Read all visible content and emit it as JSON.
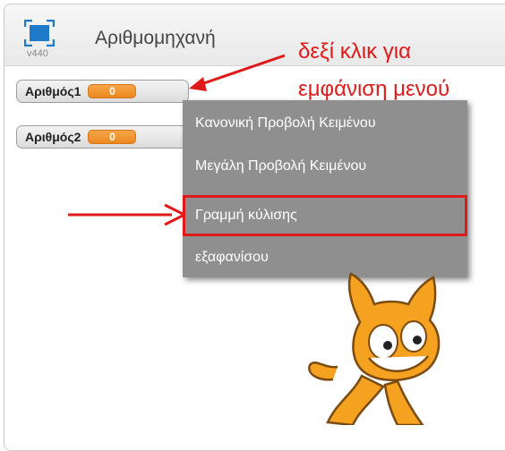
{
  "app": {
    "version": "v440",
    "project_title": "Αριθμομηχανή"
  },
  "watchers": [
    {
      "label": "Αριθμός1",
      "value": "0"
    },
    {
      "label": "Αριθμός2",
      "value": "0"
    }
  ],
  "annotation": {
    "line1": "δεξί κλικ για",
    "line2": "εμφάνιση μενού"
  },
  "context_menu": {
    "items": [
      {
        "label": "Κανονική Προβολή Κειμένου"
      },
      {
        "label": "Μεγάλη Προβολή Κειμένου"
      },
      {
        "label": "Γραμμή κύλισης",
        "highlighted": true
      },
      {
        "label": "εξαφανίσου"
      }
    ]
  },
  "colors": {
    "accent_red": "#e01919",
    "watcher_orange": "#f09324",
    "menu_gray": "#8f8f8f"
  },
  "icons": [
    "fullscreen-stage-icon",
    "red-arrow",
    "scratch-cat-sprite"
  ]
}
